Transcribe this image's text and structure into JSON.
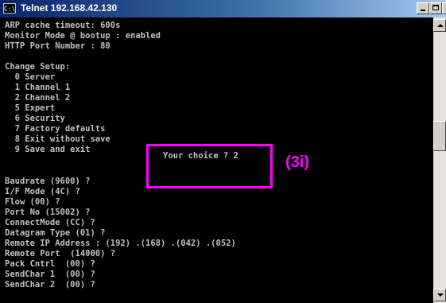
{
  "window": {
    "title": "Telnet 192.168.42.130",
    "icon_text": "C:\\",
    "colors": {
      "titlebar": "#0a246a",
      "console_bg": "#000000",
      "console_text": "#c0c0c0",
      "annotation": "#ff00ff"
    }
  },
  "console": {
    "lines": [
      "ARP cache timeout: 600s",
      "Monitor Mode @ bootup : enabled",
      "HTTP Port Number : 80",
      "",
      "Change Setup:",
      "  0 Server",
      "  1 Channel 1",
      "  2 Channel 2",
      "  5 Expert",
      "  6 Security",
      "  7 Factory defaults",
      "  8 Exit without save",
      "  9 Save and exit",
      "",
      "Baudrate (9600) ?",
      "I/F Mode (4C) ?",
      "Flow (00) ?",
      "Port No (15002) ?",
      "ConnectMode (CC) ?",
      "Datagram Type (01) ?",
      "Remote IP Address : (192) .(168) .(042) .(052)",
      "Remote Port  (14000) ?",
      "Pack Cntrl  (00) ?",
      "SendChar 1  (00) ?",
      "SendChar 2  (00) ?"
    ],
    "choice_prompt": "Your choice ? 2"
  },
  "annotation": {
    "label": "(3i)"
  },
  "scrollbar": {
    "up_icon": "arrow-up",
    "down_icon": "arrow-down"
  }
}
